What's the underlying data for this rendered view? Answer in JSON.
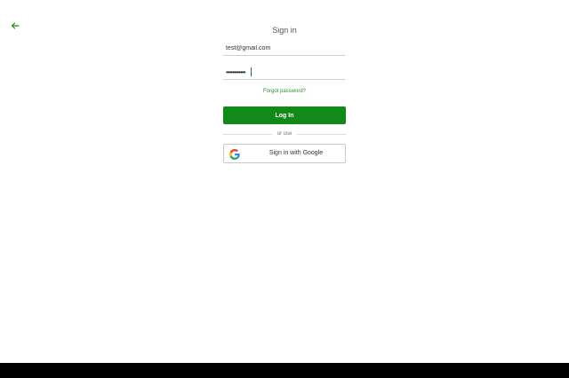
{
  "header": {
    "title": "Sign in",
    "back_icon": "arrow-left-icon"
  },
  "form": {
    "email_value": "test@gmail.com",
    "password_value": "••••••••••••",
    "forgot_label": "Forgot password?",
    "login_label": "Log In",
    "divider_label": "or use",
    "google_label": "Sign in with Google",
    "google_icon": "google-logo-icon"
  },
  "colors": {
    "accent": "#118a1a",
    "link": "#2e8b2e",
    "background": "#ffffff",
    "nav_bar": "#000000"
  }
}
